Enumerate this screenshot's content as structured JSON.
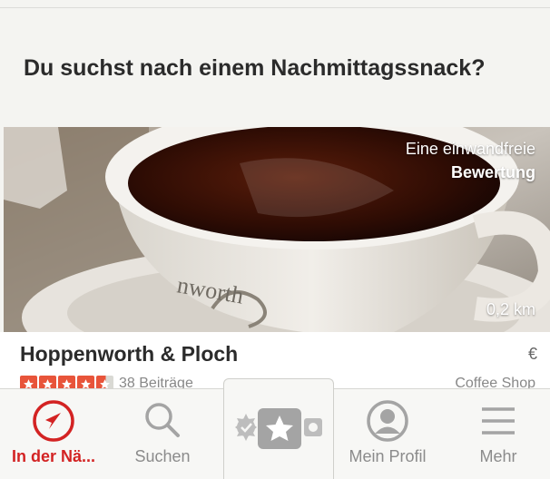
{
  "headline": "Du suchst nach einem Nachmittagssnack?",
  "card": {
    "photo_caption_line1": "Eine einwandfreie",
    "photo_caption_line2": "Bewertung",
    "distance": "0,2 km",
    "cup_text": "nworth",
    "business_name": "Hoppenworth & Ploch",
    "price": "€",
    "rating_stars": 4.5,
    "reviews": "38 Beiträge",
    "category": "Coffee Shop"
  },
  "tabs": [
    {
      "label": "In der Nä...",
      "icon": "location-arrow-icon",
      "active": true
    },
    {
      "label": "Suchen",
      "icon": "search-icon",
      "active": false
    },
    {
      "label": "",
      "icon": "review-star-camera-icon",
      "active": false
    },
    {
      "label": "Mein Profil",
      "icon": "profile-icon",
      "active": false
    },
    {
      "label": "Mehr",
      "icon": "menu-lines-icon",
      "active": false
    }
  ],
  "colors": {
    "brand_red": "#d32323",
    "star_red": "#e8543a",
    "inactive_gray": "#8b8b8b"
  }
}
